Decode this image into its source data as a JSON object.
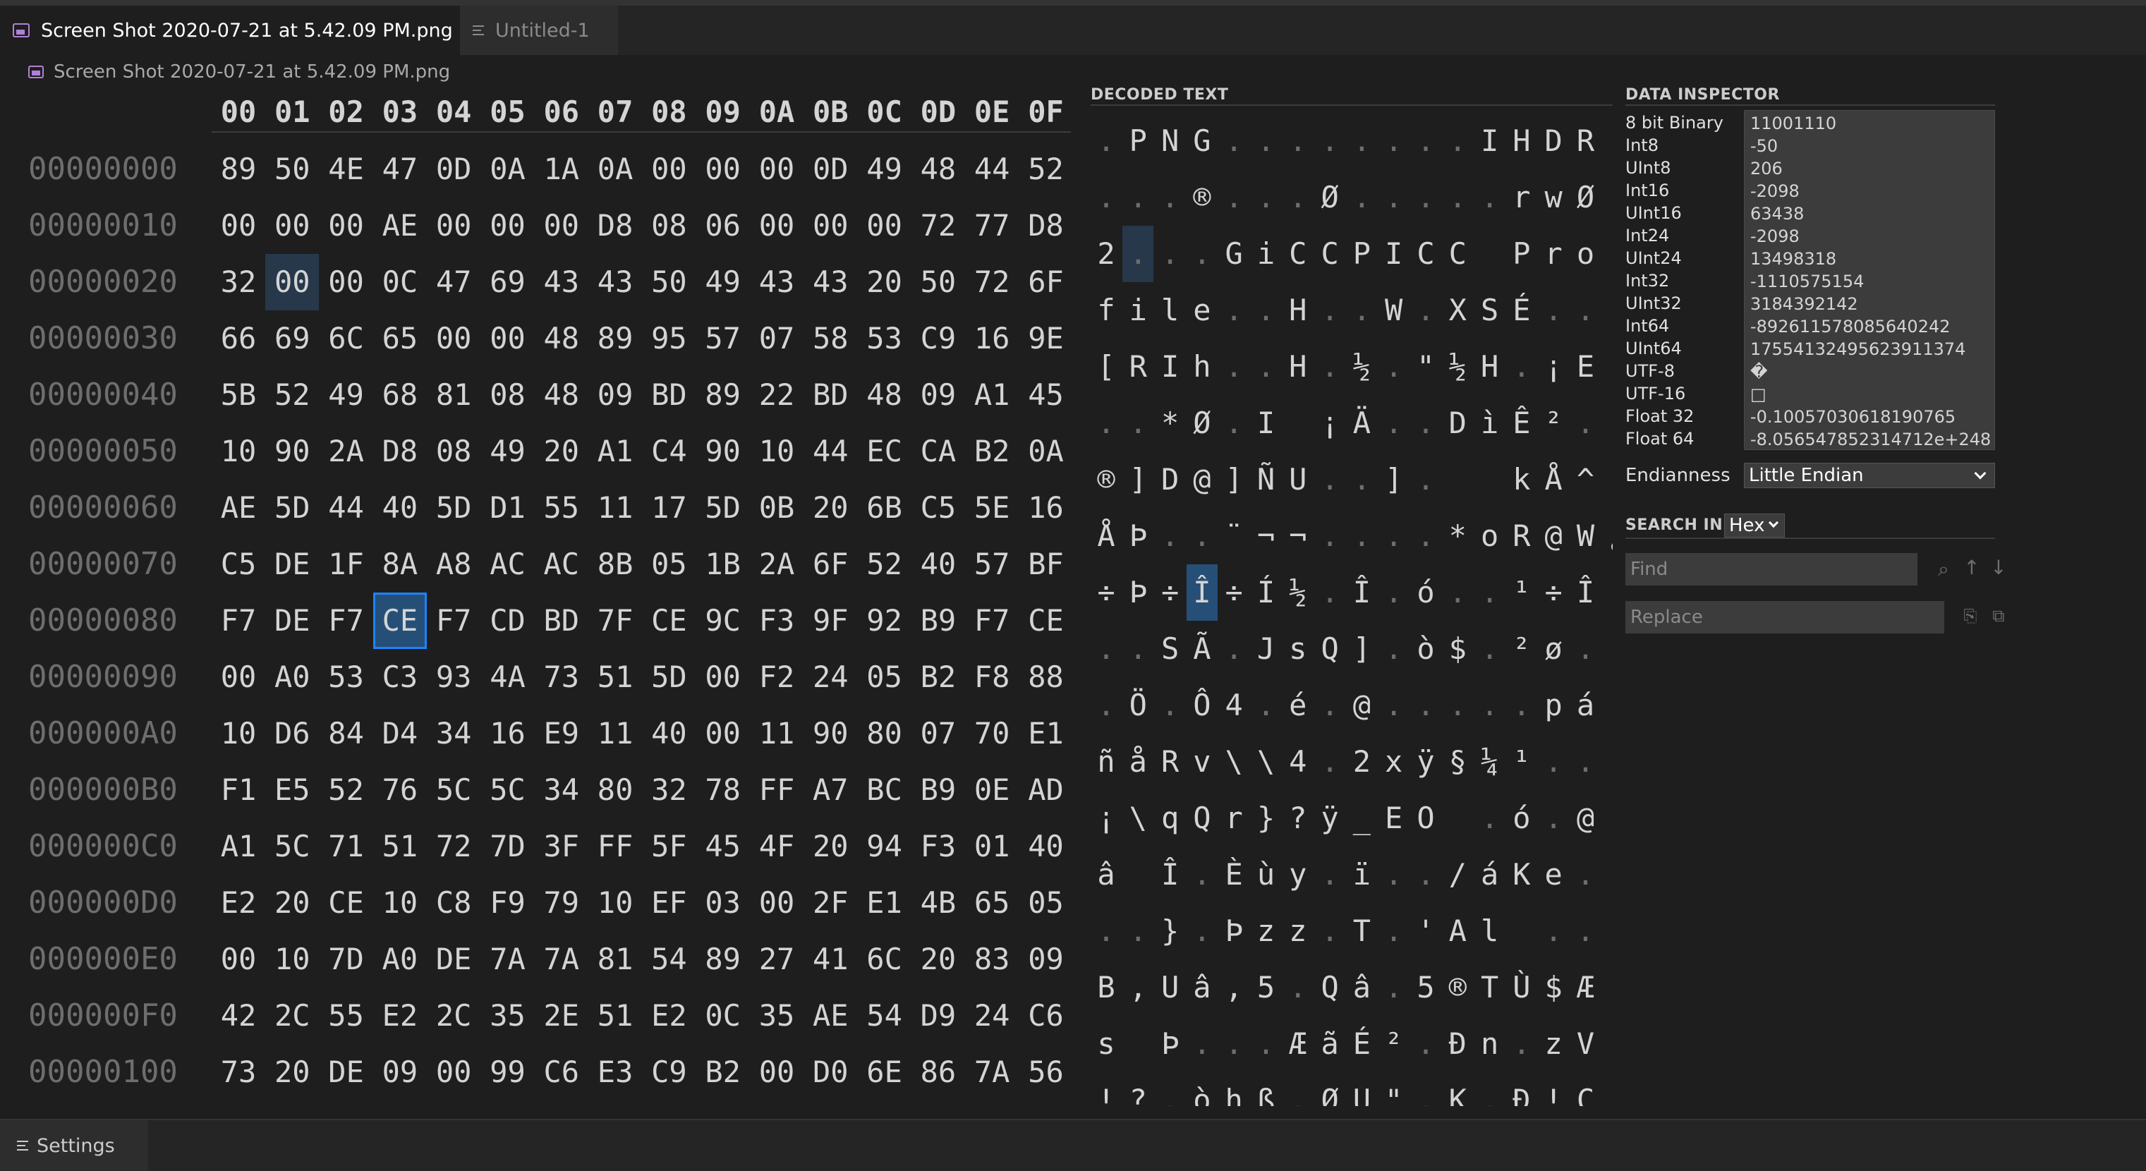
{
  "tabs": [
    {
      "label": "Screen Shot 2020-07-21 at 5.42.09 PM.png",
      "icon": "image-file-icon",
      "active": true
    },
    {
      "label": "Untitled-1",
      "icon": "text-file-icon",
      "active": false
    }
  ],
  "breadcrumb": {
    "label": "Screen Shot 2020-07-21 at 5.42.09 PM.png",
    "icon": "image-file-icon"
  },
  "hex_header": [
    "00",
    "01",
    "02",
    "03",
    "04",
    "05",
    "06",
    "07",
    "08",
    "09",
    "0A",
    "0B",
    "0C",
    "0D",
    "0E",
    "0F"
  ],
  "offsets": [
    "00000000",
    "00000010",
    "00000020",
    "00000030",
    "00000040",
    "00000050",
    "00000060",
    "00000070",
    "00000080",
    "00000090",
    "000000A0",
    "000000B0",
    "000000C0",
    "000000D0",
    "000000E0",
    "000000F0",
    "00000100"
  ],
  "hex_rows": [
    "89 50 4E 47 0D 0A 1A 0A 00 00 00 0D 49 48 44 52",
    "00 00 00 AE 00 00 00 D8 08 06 00 00 00 72 77 D8",
    "32 00 00 0C 47 69 43 43 50 49 43 43 20 50 72 6F",
    "66 69 6C 65 00 00 48 89 95 57 07 58 53 C9 16 9E",
    "5B 52 49 68 81 08 48 09 BD 89 22 BD 48 09 A1 45",
    "10 90 2A D8 08 49 20 A1 C4 90 10 44 EC CA B2 0A",
    "AE 5D 44 40 5D D1 55 11 17 5D 0B 20 6B C5 5E 16",
    "C5 DE 1F 8A A8 AC AC 8B 05 1B 2A 6F 52 40 57 BF",
    "F7 DE F7 CE F7 CD BD 7F CE 9C F3 9F 92 B9 F7 CE",
    "00 A0 53 C3 93 4A 73 51 5D 00 F2 24 05 B2 F8 88",
    "10 D6 84 D4 34 16 E9 11 40 00 11 90 80 07 70 E1",
    "F1 E5 52 76 5C 5C 34 80 32 78 FF A7 BC B9 0E AD",
    "A1 5C 71 51 72 7D 3F FF 5F 45 4F 20 94 F3 01 40",
    "E2 20 CE 10 C8 F9 79 10 EF 03 00 2F E1 4B 65 05",
    "00 10 7D A0 DE 7A 7A 81 54 89 27 41 6C 20 83 09",
    "42 2C 55 E2 2C 35 2E 51 E2 0C 35 AE 54 D9 24 C6",
    "73 20 DE 09 00 99 C6 E3 C9 B2 00 D0 6E 86 7A 56"
  ],
  "hex_highlight": {
    "row": 2,
    "col": 1
  },
  "hex_selected": {
    "row": 8,
    "col": 3
  },
  "decoded_title": "DECODED TEXT",
  "decoded_rows": [
    ".PNG........IHDR",
    "...®...Ø.....rwØ",
    "2...GiCCPICC Pro",
    "file..H..W.XSÉ..",
    "[RIh..H.½.\"½H.¡E",
    "..*Ø.I ¡Ä..DìÊ².",
    "®]D@]ÑU..].  kÅ^.",
    "ÅÞ..¨¬¬....*oR@W¿",
    "÷Þ÷Î÷Í½.Î.ó..¹÷Î",
    "..SÃ.JsQ].ò$.²ø.",
    ".Ö.Ô4.é.@.....pá",
    "ñåRv\\\\4.2xÿ§¼¹..",
    "¡\\qQr}?ÿ_EO .ó.@",
    "â Î.Èùy.ï../áKe.",
    "..}.Þzz.T.'Al ..",
    "B,Uâ,5.Qâ.5®TÙ$Æ",
    "s Þ...ÆãÉ².Ðn.zV",
    "!?.òhß.ØU\".K.Ð!C"
  ],
  "decoded_highlight": {
    "row": 2,
    "col": 1
  },
  "decoded_selected": {
    "row": 8,
    "col": 3
  },
  "inspector": {
    "title": "DATA INSPECTOR",
    "rows": [
      {
        "label": "8 bit Binary",
        "value": "11001110"
      },
      {
        "label": "Int8",
        "value": "-50"
      },
      {
        "label": "UInt8",
        "value": "206"
      },
      {
        "label": "Int16",
        "value": "-2098"
      },
      {
        "label": "UInt16",
        "value": "63438"
      },
      {
        "label": "Int24",
        "value": "-2098"
      },
      {
        "label": "UInt24",
        "value": "13498318"
      },
      {
        "label": "Int32",
        "value": "-1110575154"
      },
      {
        "label": "UInt32",
        "value": "3184392142"
      },
      {
        "label": "Int64",
        "value": "-892611578085640242"
      },
      {
        "label": "UInt64",
        "value": "17554132495623911374"
      },
      {
        "label": "UTF-8",
        "value": "�"
      },
      {
        "label": "UTF-16",
        "value": "□"
      },
      {
        "label": "Float 32",
        "value": "-0.10057030618190765"
      },
      {
        "label": "Float 64",
        "value": "-8.056547852314712e+248"
      }
    ],
    "endianness_label": "Endianness",
    "endianness_value": "Little Endian"
  },
  "search": {
    "title": "SEARCH IN",
    "mode": "Hex",
    "find_placeholder": "Find",
    "replace_placeholder": "Replace"
  },
  "status": {
    "settings_label": "Settings"
  }
}
